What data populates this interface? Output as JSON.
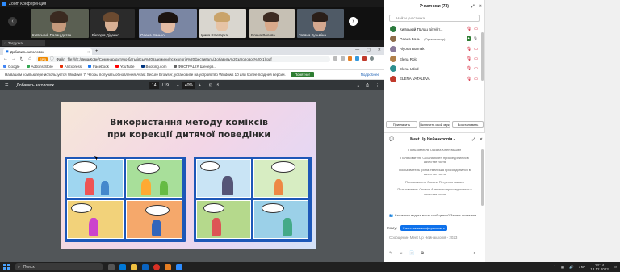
{
  "zoom": {
    "title": "Zoom Конференция"
  },
  "gallery": {
    "tiles": [
      {
        "name": "Київський Палац дитяч..."
      },
      {
        "name": "Вікторія Діденко"
      },
      {
        "name": "Олена Ванько"
      },
      {
        "name": "Ірина Шпетарка"
      },
      {
        "name": "Елена Волова"
      },
      {
        "name": "Тетяна Кузьміна"
      }
    ],
    "loading": "Загрузка..."
  },
  "browser": {
    "tab_label": "Добавить заголовок",
    "url": "file:///E:/Лена/Ковн/Семинар/дитячо-батьківськ%20взаємини/психологія%20фестиваль/Добавить%20заголовок%20(1).pdf",
    "url_scheme_label": "Файл",
    "secure_badge": "SPB",
    "bookmarks": [
      {
        "label": "Google",
        "color": "#4285f4"
      },
      {
        "label": "Addons Store",
        "color": "#34a853"
      },
      {
        "label": "AliExpress",
        "color": "#e62e04"
      },
      {
        "label": "Facebook",
        "color": "#1877f2"
      },
      {
        "label": "YouTube",
        "color": "#ff0000"
      },
      {
        "label": "Booking.com",
        "color": "#003580"
      },
      {
        "label": "ФНСТРАЦІЯ Шенерв...",
        "color": "#666666"
      }
    ],
    "infobar_text": "На вашем компьютере используется Windows 7. Чтобы получать обновления Avast Secure Browser, установите на устройство Windows 10 или более поздней версии.",
    "infobar_button": "Понятно!",
    "infobar_link": "Подробнее"
  },
  "pdf": {
    "title": "Добавить заголовок",
    "page_current": "14",
    "page_total": "/ 19",
    "zoom": "40%",
    "slide_title_line1": "Використання методу коміксів",
    "slide_title_line2": "при корекції дитячої поведінки"
  },
  "participants": {
    "title": "Участники (73)",
    "search_placeholder": "Найти участника",
    "list": [
      {
        "name": "Київський Палац дітей т...",
        "color": "#2b7a3d",
        "tag": ""
      },
      {
        "name": "Олена Баль...",
        "color": "#8c6b4a",
        "tag": "(Организатор)"
      },
      {
        "name": "Alyona Burmak",
        "color": "#8a7a9a",
        "tag": ""
      },
      {
        "name": "Elena Rolo",
        "color": "#b0804a",
        "tag": ""
      },
      {
        "name": "Elena Udod",
        "color": "#2d8f8f",
        "tag": ""
      },
      {
        "name": "ELENA VATALEVA",
        "color": "#c0392b",
        "tag": ""
      }
    ],
    "actions": [
      "Пригласить",
      "Включить свой звук",
      "Восстановить"
    ]
  },
  "chat": {
    "title": "Meet Up Нейнаклопія - ...",
    "messages": [
      "Пользователь Оксана Кінен вышел",
      "Пользователь Оксана Кінен присоединился в качестве гостя",
      "Пользователь Ірина Уманська присоединился в качестве гостя",
      "Пользователь Оксана Петренко вышел",
      "Пользователь Оксана Апененко присоединился в качестве гостя"
    ],
    "notice": "Кто может видеть ваши сообщения? Запись включена",
    "to_label": "Кому:",
    "to_value": "Участникам конференции",
    "placeholder": "Сообщение Meet Up Нейнаклопія - 2023"
  },
  "taskbar": {
    "search_label": "Поиск",
    "lang": "УКР",
    "time": "13:14",
    "date": "13.12.2023"
  }
}
